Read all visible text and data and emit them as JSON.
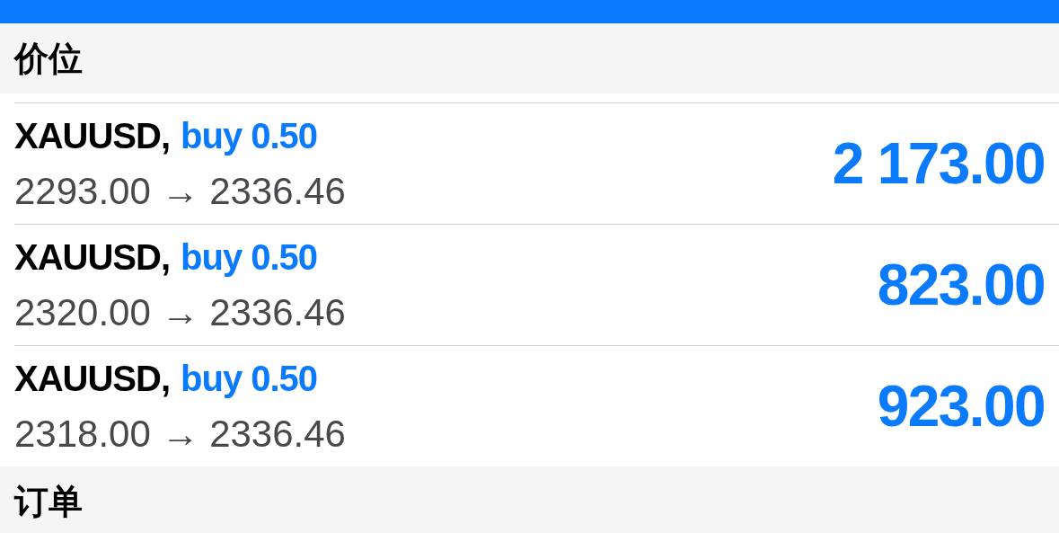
{
  "sections": [
    {
      "title": "价位",
      "positions": [
        {
          "symbol": "XAUUSD,",
          "side": "buy 0.50",
          "prices": "2293.00 → 2336.46",
          "profit": "2 173.00"
        },
        {
          "symbol": "XAUUSD,",
          "side": "buy 0.50",
          "prices": "2320.00 → 2336.46",
          "profit": "823.00"
        },
        {
          "symbol": "XAUUSD,",
          "side": "buy 0.50",
          "prices": "2318.00 → 2336.46",
          "profit": "923.00"
        }
      ]
    },
    {
      "title": "订单"
    }
  ]
}
